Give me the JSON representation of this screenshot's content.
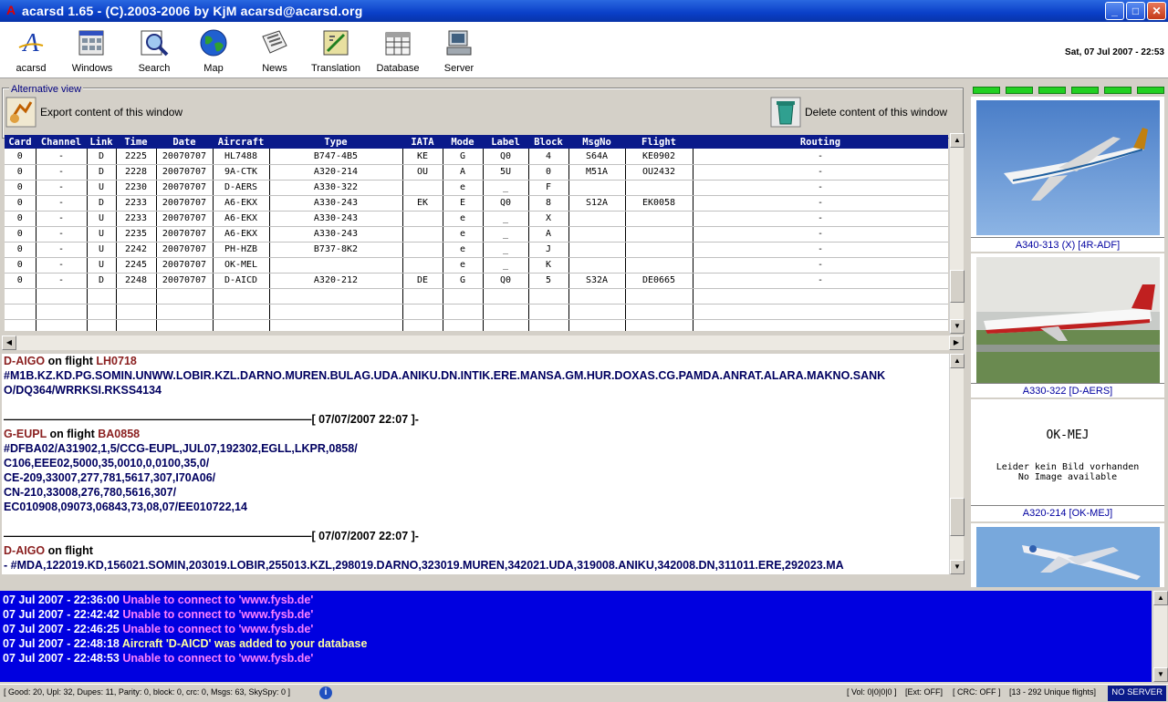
{
  "window": {
    "title": "acarsd 1.65 - (C).2003-2006 by KjM acarsd@acarsd.org",
    "minimize": "_",
    "maximize": "□",
    "close": "✕"
  },
  "toolbar": {
    "items": [
      {
        "label": "acarsd",
        "icon": "acarsd-logo-icon"
      },
      {
        "label": "Windows",
        "icon": "windows-icon"
      },
      {
        "label": "Search",
        "icon": "search-icon"
      },
      {
        "label": "Map",
        "icon": "globe-icon"
      },
      {
        "label": "News",
        "icon": "newspaper-icon"
      },
      {
        "label": "Translation",
        "icon": "translation-icon"
      },
      {
        "label": "Database",
        "icon": "database-icon"
      },
      {
        "label": "Server",
        "icon": "server-icon"
      }
    ],
    "datetime": "Sat, 07 Jul 2007 - 22:53"
  },
  "altview": {
    "legend": "Alternative view",
    "export_label": "Export content of this window",
    "delete_label": "Delete content of this window"
  },
  "grid": {
    "columns": [
      "Card",
      "Channel",
      "Link",
      "Time",
      "Date",
      "Aircraft",
      "Type",
      "IATA",
      "Mode",
      "Label",
      "Block",
      "MsgNo",
      "Flight",
      "Routing"
    ],
    "rows": [
      [
        "0",
        "-",
        "D",
        "2225",
        "20070707",
        "HL7488",
        "B747-4B5",
        "KE",
        "G",
        "Q0",
        "4",
        "S64A",
        "KE0902",
        "-"
      ],
      [
        "0",
        "-",
        "D",
        "2228",
        "20070707",
        "9A-CTK",
        "A320-214",
        "OU",
        "A",
        "5U",
        "0",
        "M51A",
        "OU2432",
        "-"
      ],
      [
        "0",
        "-",
        "U",
        "2230",
        "20070707",
        "D-AERS",
        "A330-322",
        "",
        "e",
        "_",
        "F",
        "",
        "",
        "-"
      ],
      [
        "0",
        "-",
        "D",
        "2233",
        "20070707",
        "A6-EKX",
        "A330-243",
        "EK",
        "E",
        "Q0",
        "8",
        "S12A",
        "EK0058",
        "-"
      ],
      [
        "0",
        "-",
        "U",
        "2233",
        "20070707",
        "A6-EKX",
        "A330-243",
        "",
        "e",
        "_",
        "X",
        "",
        "",
        "-"
      ],
      [
        "0",
        "-",
        "U",
        "2235",
        "20070707",
        "A6-EKX",
        "A330-243",
        "",
        "e",
        "_",
        "A",
        "",
        "",
        "-"
      ],
      [
        "0",
        "-",
        "U",
        "2242",
        "20070707",
        "PH-HZB",
        "B737-8K2",
        "",
        "e",
        "_",
        "J",
        "",
        "",
        "-"
      ],
      [
        "0",
        "-",
        "U",
        "2245",
        "20070707",
        "OK-MEL",
        "",
        "",
        "e",
        "_",
        "K",
        "",
        "",
        "-"
      ],
      [
        "0",
        "-",
        "D",
        "2248",
        "20070707",
        "D-AICD",
        "A320-212",
        "DE",
        "G",
        "Q0",
        "5",
        "S32A",
        "DE0665",
        "-"
      ]
    ]
  },
  "log": {
    "msg1_reg": "D-AIGO",
    "msg1_mid": " on flight ",
    "msg1_flight": "LH0718",
    "msg1_body1": "#M1B.KZ.KD.PG.SOMIN.UNWW.LOBIR.KZL.DARNO.MUREN.BULAG.UDA.ANIKU.DN.INTIK.ERE.MANSA.GM.HUR.DOXAS.CG.PAMDA.ANRAT.ALARA.MAKNO.SANK",
    "msg1_body2": "O/DQ364/WRRKSI.RKSS4134",
    "sep1": "———————————————————————————[ 07/07/2007 22:07 ]-",
    "msg2_reg": "G-EUPL",
    "msg2_mid": " on flight ",
    "msg2_flight": "BA0858",
    "msg2_body1": "#DFBA02/A31902,1,5/CCG-EUPL,JUL07,192302,EGLL,LKPR,0858/",
    "msg2_body2": "C106,EEE02,5000,35,0010,0,0100,35,0/",
    "msg2_body3": "CE-209,33007,277,781,5617,307,I70A06/",
    "msg2_body4": "CN-210,33008,276,780,5616,307/",
    "msg2_body5": "EC010908,09073,06843,73,08,07/EE010722,14",
    "sep2": "———————————————————————————[ 07/07/2007 22:07 ]-",
    "msg3_reg": "D-AIGO",
    "msg3_mid": " on flight",
    "msg3_body1": "- #MDA,122019.KD,156021.SOMIN,203019.LOBIR,255013.KZL,298019.DARNO,323019.MUREN,342021.UDA,319008.ANIKU,342008.DN,311011.ERE,292023.MA"
  },
  "images": {
    "pic1_caption": "A340-313 (X) [4R-ADF]",
    "pic2_caption": "A330-322 [D-AERS]",
    "pic3_reg": "OK-MEJ",
    "pic3_line1": "Leider kein Bild vorhanden",
    "pic3_line2": "No Image available",
    "pic3_caption": "A320-214 [OK-MEJ]"
  },
  "messages": [
    {
      "ts": "07 Jul 2007 - 22:36:00",
      "text": "Unable to connect to 'www.fysb.de'",
      "kind": "err"
    },
    {
      "ts": "07 Jul 2007 - 22:42:42",
      "text": "Unable to connect to 'www.fysb.de'",
      "kind": "err"
    },
    {
      "ts": "07 Jul 2007 - 22:46:25",
      "text": "Unable to connect to 'www.fysb.de'",
      "kind": "err"
    },
    {
      "ts": "07 Jul 2007 - 22:48:18",
      "text_pre": "Aircraft ",
      "text_reg": "'D-AICD'",
      "text_post": " was added to your database",
      "kind": "ok"
    },
    {
      "ts": "07 Jul 2007 - 22:48:53",
      "text": "Unable to connect to 'www.fysb.de'",
      "kind": "err"
    }
  ],
  "status": {
    "counts": "[ Good: 20, Upl: 32, Dupes: 11, Parity: 0, block: 0, crc: 0, Msgs: 63, SkySpy: 0 ]",
    "vol": "[ Vol: 0|0|0|0 ]",
    "ext": "[Ext: OFF]",
    "crc": "[ CRC: OFF ]",
    "flights": "[13 - 292 Unique flights]",
    "server": "NO SERVER"
  },
  "colors": {
    "titlebar": "#0a3fc8",
    "grid_header": "#0a1a8a",
    "messages_bg": "#0000e0",
    "message_error": "#ff80ff",
    "message_ok": "#ffffa0",
    "led": "#22d022"
  }
}
